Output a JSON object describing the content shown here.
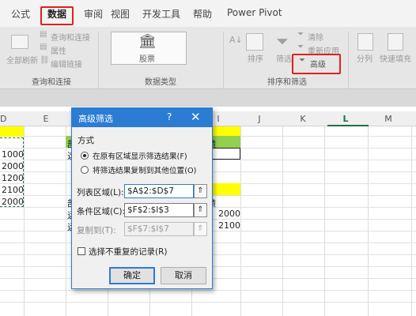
{
  "ribbon": {
    "tabs": [
      "公式",
      "数据",
      "审阅",
      "视图",
      "开发工具",
      "帮助",
      "Power Pivot"
    ],
    "active_tab": "数据",
    "refresh_all": "全部刷新",
    "query_connect": "查询和连接",
    "properties": "属性",
    "edit_links": "编辑链接",
    "group_query": "查询和连接",
    "stocks": "股票",
    "group_datatype": "数据类型",
    "sort": "排序",
    "filter": "筛选",
    "clear": "清除",
    "reapply": "重新应用",
    "advanced": "高级",
    "group_sortfilter": "排序和筛选",
    "split": "分列",
    "flash_fill": "快速填充"
  },
  "grid": {
    "columns": [
      "D",
      "E",
      "F",
      "G",
      "H",
      "I",
      "J",
      "K",
      "L",
      "M"
    ],
    "selected_column": "L",
    "d_values": [
      "1000",
      "2000",
      "1200",
      "2100",
      "2000"
    ],
    "f_top_partial": "部",
    "f_top_partial2": "这",
    "i_top_partial": "绩",
    "f_bot_1": "部",
    "f_bot_2": "运",
    "f_bot_3": "运",
    "i_bot_header": "绩",
    "i_bot_1": "2000",
    "i_bot_2": "2100"
  },
  "dialog": {
    "title": "高级筛选",
    "help": "?",
    "close": "✕",
    "mode_label": "方式",
    "option_inplace": "在原有区域显示筛选结果(F)",
    "option_copy": "将筛选结果复制到其他位置(O)",
    "list_range_label": "列表区域(L):",
    "list_range_value": "$A$2:$D$7",
    "criteria_label": "条件区域(C):",
    "criteria_value": "$F$2:$I$3",
    "copy_to_label": "复制到(T):",
    "copy_to_value": "$F$7:$I$7",
    "unique_label": "选择不重复的记录(R)",
    "ok": "确定",
    "cancel": "取消"
  },
  "colors": {
    "accent": "#2b7cd3",
    "excel_green": "#1e7145",
    "highlight_red": "#e02020",
    "yellow": "#ffff00",
    "green": "#92d050"
  }
}
